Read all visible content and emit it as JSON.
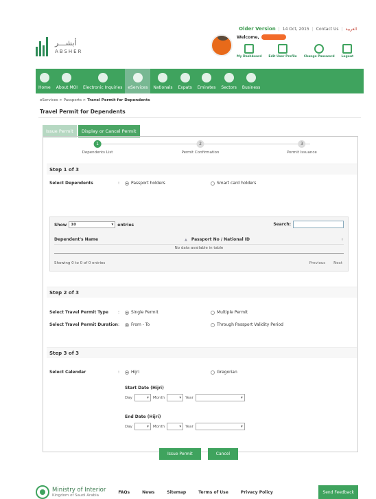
{
  "top_links": {
    "older_version": "Older Version",
    "date": "14 Oct, 2015",
    "contact": "Contact Us",
    "arabic": "العربية"
  },
  "logo": {
    "arabic": "أبشـــر",
    "latin": "ABSHER"
  },
  "user": {
    "welcome": "Welcome,",
    "links": [
      "My Dashboard",
      "Edit User Profile",
      "Change Password",
      "Logout"
    ]
  },
  "nav": [
    "Home",
    "About MOI",
    "Electronic Inquiries",
    "eServices",
    "Nationals",
    "Expats",
    "Emirates",
    "Sectors",
    "Business"
  ],
  "breadcrumb": {
    "items": [
      "eServices",
      "Passports",
      "Travel Permit for Dependents"
    ],
    "sep": ">"
  },
  "page_title": "Travel Permit for Dependents",
  "tabs": [
    "Issue Permit",
    "Display or Cancel Permit"
  ],
  "steps": [
    {
      "num": "1",
      "label": "Dependents List"
    },
    {
      "num": "2",
      "label": "Permit Confirmation"
    },
    {
      "num": "3",
      "label": "Permit Issuance"
    }
  ],
  "step1": {
    "title": "Step 1 of 3",
    "select_label": "Select Dependents",
    "options": [
      "Passport holders",
      "Smart card holders"
    ],
    "table": {
      "show": "Show",
      "entries_value": "10",
      "entries": "entries",
      "search": "Search:",
      "col1": "Dependent's Name",
      "col2": "Passport No / National ID",
      "empty": "No data available in table",
      "info": "Showing 0 to 0 of 0 entries",
      "prev": "Previous",
      "next": "Next"
    }
  },
  "step2": {
    "title": "Step 2 of 3",
    "type_label": "Select Travel Permit Type",
    "type_options": [
      "Single Permit",
      "Multiple Permit"
    ],
    "duration_label": "Select Travel Permit Duration",
    "duration_options": [
      "From - To",
      "Through Passport Validity Period"
    ]
  },
  "step3": {
    "title": "Step 3 of 3",
    "calendar_label": "Select Calendar",
    "calendar_options": [
      "Hijri",
      "Gregorian"
    ],
    "start_label": "Start Date (Hijri)",
    "end_label": "End Date (Hijri)",
    "day": "Day",
    "month": "Month",
    "year": "Year"
  },
  "colon": ":",
  "buttons": {
    "issue": "Issue Permit",
    "cancel": "Cancel"
  },
  "footer": {
    "moi": "Ministry of Interior",
    "kingdom": "Kingdom of Saudi Arabia",
    "links": [
      "FAQs",
      "News",
      "Sitemap",
      "Terms of Use",
      "Privacy Policy"
    ],
    "feedback": "Send Feedback"
  },
  "colors": {
    "accent": "#3fa35e",
    "active_nav": "#78b893",
    "username_mask": "#f26b2a"
  }
}
